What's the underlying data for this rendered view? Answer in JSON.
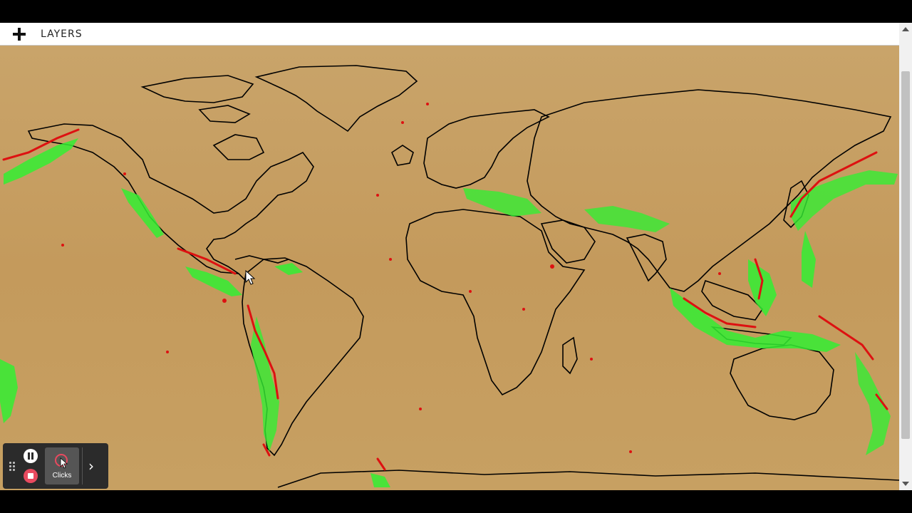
{
  "toolbar": {
    "add_icon": "plus-icon",
    "layers_label": "LAYERS"
  },
  "map": {
    "land_color": "#c8a062",
    "coastline_color": "#000000",
    "shallow_quake_color": "#33ee33",
    "deep_quake_color": "#dd1111"
  },
  "recorder": {
    "grip_icon": "grip-icon",
    "pause_icon": "pause-icon",
    "stop_icon": "stop-icon",
    "clicks_label": "Clicks",
    "expand_icon": "chevron-right-icon"
  }
}
